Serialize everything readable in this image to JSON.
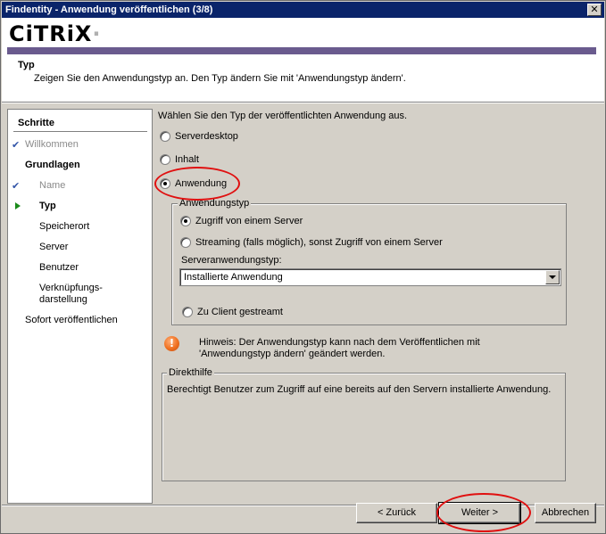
{
  "window": {
    "title": "Findentity - Anwendung veröffentlichen (3/8)",
    "close_glyph": "✕"
  },
  "header": {
    "logo_text": "CiTRiX",
    "logo_dot": "·",
    "title": "Typ",
    "subtitle": "Zeigen Sie den Anwendungstyp an. Den Typ ändern Sie mit 'Anwendungstyp ändern'."
  },
  "sidebar": {
    "title": "Schritte",
    "items": [
      {
        "label": "Willkommen",
        "state": "done",
        "mark": "check"
      },
      {
        "label": "Grundlagen",
        "state": "group"
      },
      {
        "label": "Name",
        "state": "done",
        "mark": "check"
      },
      {
        "label": "Typ",
        "state": "current",
        "mark": "arrow"
      },
      {
        "label": "Speicherort",
        "state": "pending"
      },
      {
        "label": "Server",
        "state": "pending"
      },
      {
        "label": "Benutzer",
        "state": "pending"
      },
      {
        "label": "Verknüpfungs-",
        "state": "pending"
      },
      {
        "label": "darstellung",
        "state": "pending"
      },
      {
        "label": "Sofort veröffentlichen",
        "state": "pending"
      }
    ]
  },
  "main": {
    "prompt": "Wählen Sie den Typ der veröffentlichten Anwendung aus.",
    "type_options": [
      {
        "label": "Serverdesktop",
        "checked": false
      },
      {
        "label": "Inhalt",
        "checked": false
      },
      {
        "label": "Anwendung",
        "checked": true
      }
    ],
    "app_type_group": {
      "legend": "Anwendungstyp",
      "options": [
        {
          "label": "Zugriff von einem Server",
          "checked": true
        },
        {
          "label": "Streaming (falls möglich), sonst Zugriff von einem Server",
          "checked": false
        }
      ],
      "server_type_label": "Serveranwendungstyp:",
      "server_type_value": "Installierte Anwendung",
      "client_stream_label": "Zu Client gestreamt",
      "client_stream_checked": false
    },
    "hint": {
      "icon_glyph": "!",
      "line1": "Hinweis: Der Anwendungstyp kann nach dem Veröffentlichen mit",
      "line2": "'Anwendungstyp ändern' geändert werden."
    },
    "help": {
      "legend": "Direkthilfe",
      "text": "Berechtigt Benutzer zum Zugriff auf eine bereits auf den Servern installierte Anwendung."
    }
  },
  "footer": {
    "back_label": "< Zurück",
    "next_label": "Weiter >",
    "cancel_label": "Abbrechen"
  },
  "colors": {
    "title_bar": "#0a246a",
    "brand_bar": "#6a5b8e",
    "annotation": "#e01010",
    "hint_icon": "#f07020"
  }
}
